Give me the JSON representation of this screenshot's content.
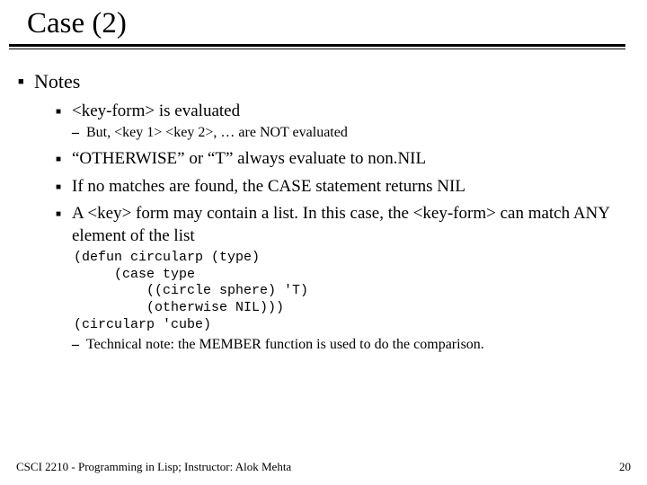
{
  "title": "Case (2)",
  "heading": "Notes",
  "items": {
    "a": {
      "text": "<key-form> is evaluated",
      "sub": "But, <key 1> <key 2>, … are NOT evaluated"
    },
    "b": "“OTHERWISE” or “T” always evaluate to non.NIL",
    "c": "If no matches are found, the CASE statement returns NIL",
    "d": {
      "text": "A <key> form may contain a list.  In this case,  the <key-form> can match ANY element of the list",
      "code": "(defun circularp (type)\n     (case type\n         ((circle sphere) 'T)\n         (otherwise NIL)))\n(circularp 'cube)",
      "note": "Technical note: the MEMBER function is used to do the comparison."
    }
  },
  "footer": {
    "left": "CSCI 2210 - Programming in Lisp; Instructor: Alok Mehta",
    "right": "20"
  }
}
